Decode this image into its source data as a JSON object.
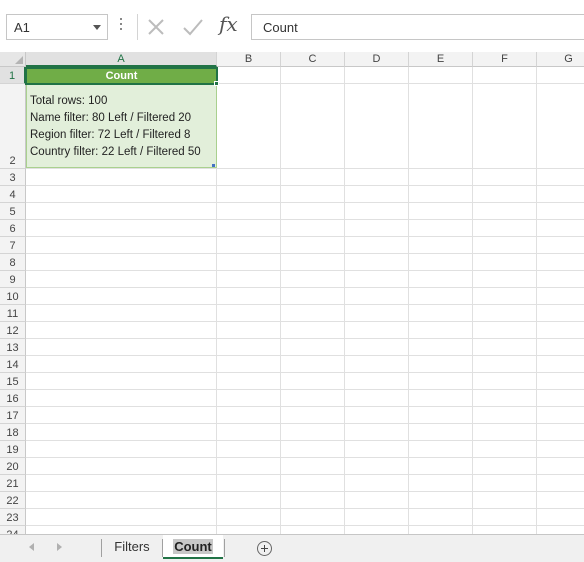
{
  "formula_bar": {
    "name_box": "A1",
    "cancel_icon": "x-icon",
    "enter_icon": "check-icon",
    "fx_label": "fx",
    "content": "Count"
  },
  "grid": {
    "columns": [
      "A",
      "B",
      "C",
      "D",
      "E",
      "F",
      "G"
    ],
    "rows": [
      "1",
      "2",
      "3",
      "4",
      "5",
      "6",
      "7",
      "8",
      "9",
      "10",
      "11",
      "12",
      "13",
      "14",
      "15",
      "16",
      "17",
      "18",
      "19",
      "20",
      "21",
      "22",
      "23",
      "24"
    ],
    "selected_cell": "A1",
    "cells": {
      "A1": "Count",
      "A2": [
        "Total rows: 100",
        "Name filter: 80 Left / Filtered 20",
        "Region filter: 72 Left / Filtered 8",
        "Country filter: 22 Left / Filtered 50"
      ]
    },
    "colors": {
      "header_fill": "#70ad47",
      "body_fill": "#e2efda",
      "accent": "#217346"
    }
  },
  "sheet_tabs": {
    "tabs": [
      "Filters",
      "Count"
    ],
    "active": "Count",
    "add_icon": "plus-circle-icon",
    "nav_prev_icon": "triangle-left-icon",
    "nav_next_icon": "triangle-right-icon"
  }
}
